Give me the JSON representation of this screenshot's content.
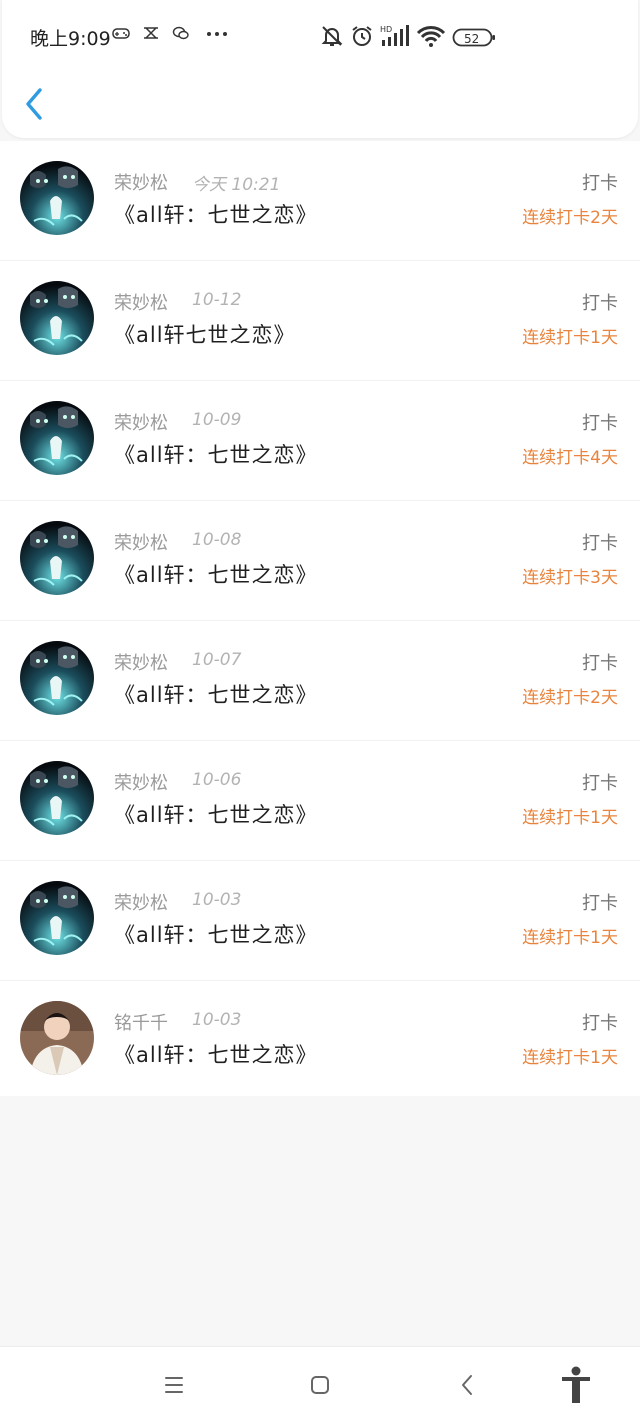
{
  "status_bar": {
    "time": "晚上9:09",
    "battery": "52"
  },
  "header": {
    "back_icon": "chevron-left-icon"
  },
  "records": [
    {
      "name": "荣妙松",
      "date": "今天 10:21",
      "title": "《all轩：七世之恋》",
      "action": "打卡",
      "streak": "连续打卡2天",
      "avatar": "dark"
    },
    {
      "name": "荣妙松",
      "date": "10-12",
      "title": "《all轩七世之恋》",
      "action": "打卡",
      "streak": "连续打卡1天",
      "avatar": "dark"
    },
    {
      "name": "荣妙松",
      "date": "10-09",
      "title": "《all轩：七世之恋》",
      "action": "打卡",
      "streak": "连续打卡4天",
      "avatar": "dark"
    },
    {
      "name": "荣妙松",
      "date": "10-08",
      "title": "《all轩：七世之恋》",
      "action": "打卡",
      "streak": "连续打卡3天",
      "avatar": "dark"
    },
    {
      "name": "荣妙松",
      "date": "10-07",
      "title": "《all轩：七世之恋》",
      "action": "打卡",
      "streak": "连续打卡2天",
      "avatar": "dark"
    },
    {
      "name": "荣妙松",
      "date": "10-06",
      "title": "《all轩：七世之恋》",
      "action": "打卡",
      "streak": "连续打卡1天",
      "avatar": "dark"
    },
    {
      "name": "荣妙松",
      "date": "10-03",
      "title": "《all轩：七世之恋》",
      "action": "打卡",
      "streak": "连续打卡1天",
      "avatar": "dark"
    },
    {
      "name": "铭千千",
      "date": "10-03",
      "title": "《all轩：七世之恋》",
      "action": "打卡",
      "streak": "连续打卡1天",
      "avatar": "photo"
    }
  ],
  "nav": {
    "menu_icon": "menu-icon",
    "home_icon": "home-square-icon",
    "back_icon": "back-triangle-icon",
    "accessibility_icon": "accessibility-icon"
  },
  "colors": {
    "streak": "#e8843d",
    "back_chevron": "#2f9be0"
  }
}
